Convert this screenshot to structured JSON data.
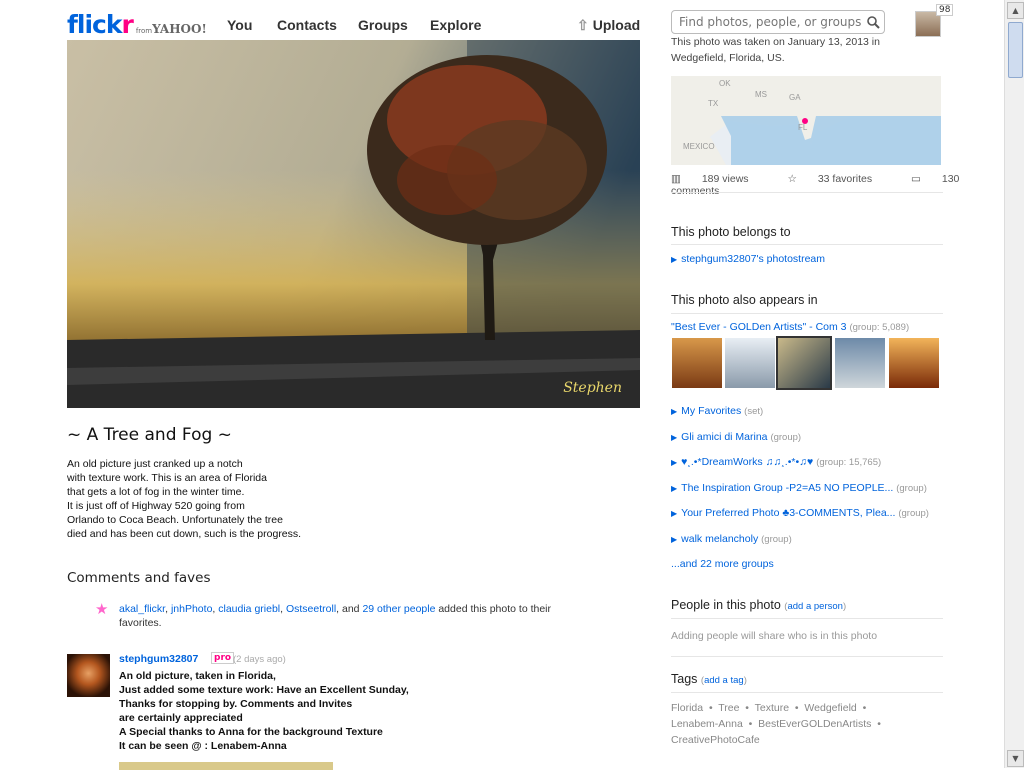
{
  "header": {
    "logo_a": "flick",
    "logo_b": "r",
    "logo_from": "from",
    "logo_yahoo": "YAHOO!",
    "nav": [
      "You",
      "Contacts",
      "Groups",
      "Explore"
    ],
    "upload": "Upload",
    "search_placeholder": "Find photos, people, or groups",
    "notification_count": "98"
  },
  "photo": {
    "signature": "Stephen",
    "title": "~ A Tree and Fog ~",
    "description": [
      "An old picture just cranked up a notch",
      "with texture work. This is an area of Florida",
      "that gets a lot of fog in the winter time.",
      "It is just off of Highway 520 going from",
      "Orlando to Coca Beach. Unfortunately the tree",
      "died and has been cut down, such is the progress."
    ]
  },
  "comments": {
    "heading": "Comments and faves",
    "fave_people": [
      "akal_flickr",
      "jnhPhoto",
      "claudia griebl",
      "Ostseetroll"
    ],
    "fave_other": "29 other people",
    "fave_suffix": "added this photo to their favorites.",
    "comment": {
      "author": "stephgum32807",
      "pro": "pro",
      "time": "(2 days ago)",
      "lines": [
        "An old picture, taken in Florida,",
        "Just added some texture work: Have an Excellent Sunday,",
        "Thanks for stopping by. Comments and Invites",
        "are certainly appreciated",
        "A Special thanks to Anna for the background Texture",
        "It can be seen @ : Lenabem-Anna"
      ]
    }
  },
  "sidebar": {
    "taken_line1": "This photo was taken on January 13, 2013 in",
    "taken_line2": "Wedgefield, Florida, US.",
    "map_labels": [
      "OK",
      "MS",
      "GA",
      "TX",
      "FL",
      "MEXICO"
    ],
    "stats": {
      "views": "189 views",
      "favorites": "33 favorites",
      "comments": "130 comments"
    },
    "belongs_heading": "This photo belongs to",
    "photostream": "stephgum32807's photostream",
    "appears_heading": "This photo also appears in",
    "featured_group": "\"Best Ever - GOLDen Artists\" - Com 3",
    "featured_meta": "(group: 5,089)",
    "groups": [
      {
        "name": "My Favorites",
        "meta": "(set)"
      },
      {
        "name": "Gli amici di Marina",
        "meta": "(group)"
      },
      {
        "name": "♥¸.•*DreamWorks ♫♫¸.•*•♫♥",
        "meta": "(group: 15,765)"
      },
      {
        "name": "The Inspiration Group -P2=A5 NO PEOPLE...",
        "meta": "(group)"
      },
      {
        "name": "Your Preferred Photo ♣3-COMMENTS, Plea...",
        "meta": "(group)"
      },
      {
        "name": "walk melancholy",
        "meta": "(group)"
      }
    ],
    "more_groups": "...and 22 more groups",
    "people_heading": "People in this photo",
    "add_person": "add a person",
    "people_note": "Adding people will share who is in this photo",
    "tags_heading": "Tags",
    "add_tag": "add a tag",
    "tags": [
      "Florida",
      "Tree",
      "Texture",
      "Wedgefield",
      "Lenabem-Anna",
      "BestEverGOLDenArtists",
      "CreativePhotoCafe"
    ]
  },
  "colors": {
    "link": "#0063dc",
    "pink": "#ff0084"
  }
}
